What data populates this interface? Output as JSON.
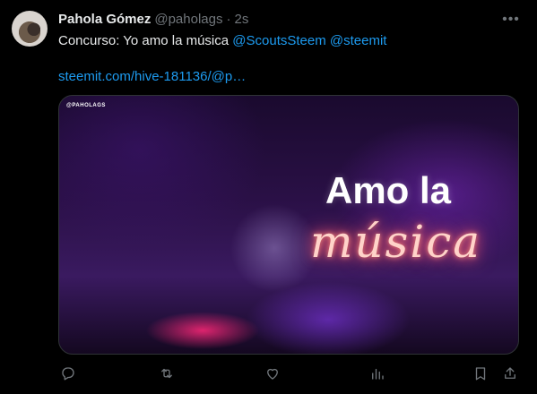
{
  "author": {
    "name": "Pahola Gómez",
    "handle": "@paholags",
    "separator": "·",
    "time": "2s"
  },
  "tweet": {
    "text": "Concurso: Yo amo la música",
    "mentions": [
      "@ScoutsSteem",
      "@steemit"
    ],
    "link": "steemit.com/hive-181136/@p…"
  },
  "media": {
    "watermark": "@PAHOLAGS",
    "line1": "Amo la",
    "line2": "música",
    "colors": {
      "title": "#ffffff",
      "neon": "#ff6f7d",
      "background": "#2a1046"
    }
  },
  "actions": [
    "reply-icon",
    "retweet-icon",
    "like-icon",
    "views-icon",
    "bookmark-icon",
    "share-icon"
  ],
  "colors": {
    "link": "#1d9bf0",
    "muted": "#71767b",
    "text": "#e7e9ea",
    "background": "#000000"
  }
}
